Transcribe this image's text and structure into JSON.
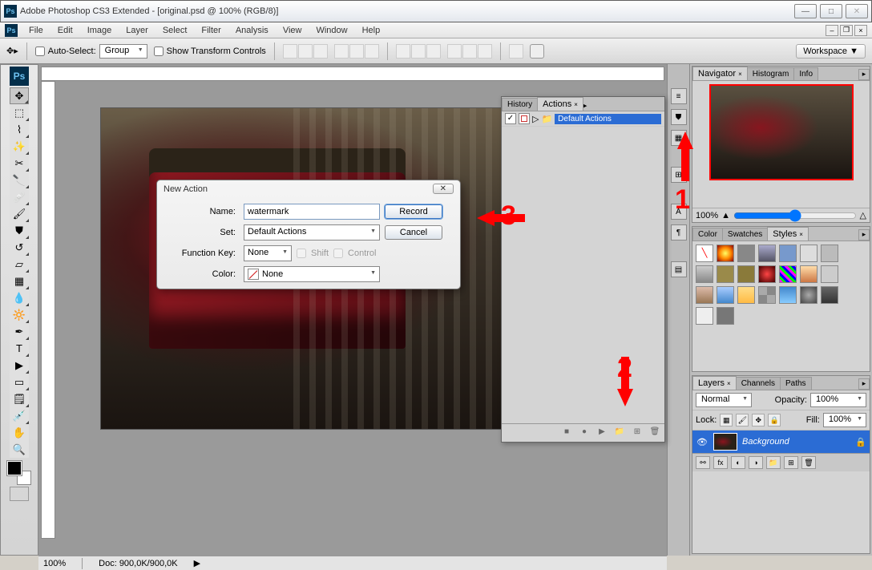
{
  "window": {
    "title": "Adobe Photoshop CS3 Extended - [original.psd @ 100% (RGB/8)]",
    "ps_badge": "Ps"
  },
  "menu": [
    "File",
    "Edit",
    "Image",
    "Layer",
    "Select",
    "Filter",
    "Analysis",
    "View",
    "Window",
    "Help"
  ],
  "options": {
    "auto_select": "Auto-Select:",
    "auto_select_mode": "Group",
    "show_transform": "Show Transform Controls",
    "workspace": "Workspace ▼"
  },
  "statusbar": {
    "zoom": "100%",
    "doc": "Doc: 900,0K/900,0K"
  },
  "navigator": {
    "tabs": [
      "Navigator",
      "Histogram",
      "Info"
    ],
    "zoom": "100%"
  },
  "styles": {
    "tabs": [
      "Color",
      "Swatches",
      "Styles"
    ]
  },
  "layers": {
    "tabs": [
      "Layers",
      "Channels",
      "Paths"
    ],
    "blend": "Normal",
    "opacity_label": "Opacity:",
    "opacity": "100%",
    "lock_label": "Lock:",
    "fill_label": "Fill:",
    "fill": "100%",
    "row_name": "Background"
  },
  "actions_panel": {
    "tabs": [
      "History",
      "Actions"
    ],
    "item": "Default Actions"
  },
  "dialog": {
    "title": "New Action",
    "name_label": "Name:",
    "name_value": "watermark",
    "set_label": "Set:",
    "set_value": "Default Actions",
    "fkey_label": "Function Key:",
    "fkey_value": "None",
    "shift": "Shift",
    "control": "Control",
    "color_label": "Color:",
    "color_value": "None",
    "record": "Record",
    "cancel": "Cancel"
  },
  "annotations": {
    "n1": "1",
    "n2": "2",
    "n3": "3"
  }
}
